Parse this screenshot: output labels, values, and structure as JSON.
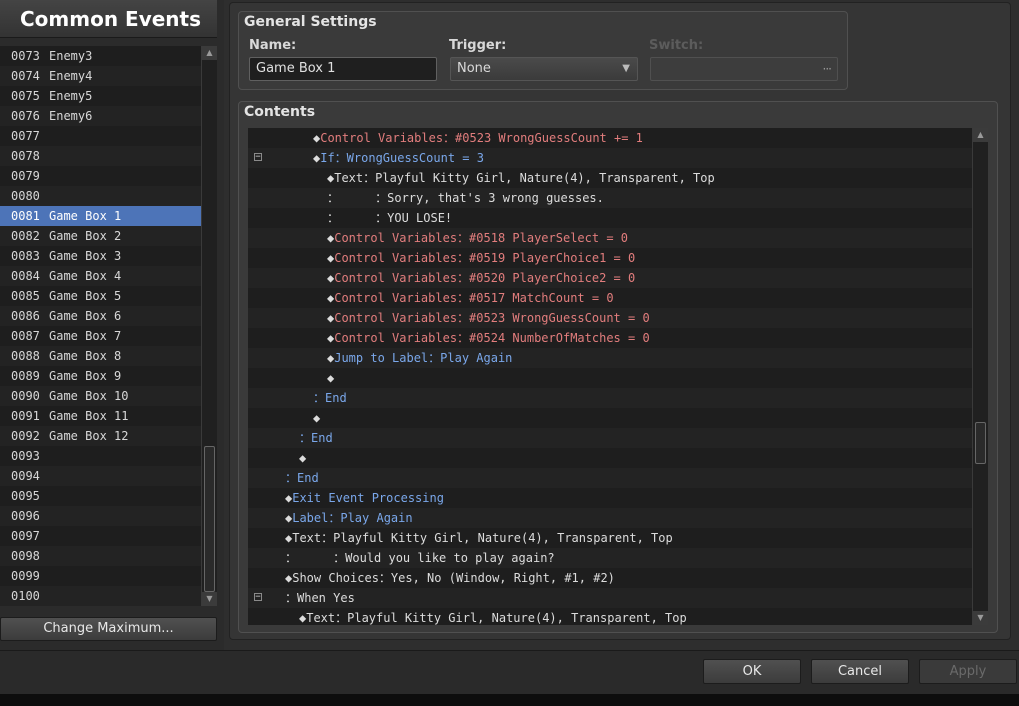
{
  "left_panel": {
    "title": "Common Events",
    "events": [
      {
        "num": "0073",
        "name": "Enemy3"
      },
      {
        "num": "0074",
        "name": "Enemy4"
      },
      {
        "num": "0075",
        "name": "Enemy5"
      },
      {
        "num": "0076",
        "name": "Enemy6"
      },
      {
        "num": "0077",
        "name": ""
      },
      {
        "num": "0078",
        "name": ""
      },
      {
        "num": "0079",
        "name": ""
      },
      {
        "num": "0080",
        "name": ""
      },
      {
        "num": "0081",
        "name": "Game Box 1",
        "selected": true
      },
      {
        "num": "0082",
        "name": "Game Box 2"
      },
      {
        "num": "0083",
        "name": "Game Box 3"
      },
      {
        "num": "0084",
        "name": "Game Box 4"
      },
      {
        "num": "0085",
        "name": "Game Box 5"
      },
      {
        "num": "0086",
        "name": "Game Box 6"
      },
      {
        "num": "0087",
        "name": "Game Box 7"
      },
      {
        "num": "0088",
        "name": "Game Box 8"
      },
      {
        "num": "0089",
        "name": "Game Box 9"
      },
      {
        "num": "0090",
        "name": "Game Box 10"
      },
      {
        "num": "0091",
        "name": "Game Box 11"
      },
      {
        "num": "0092",
        "name": "Game Box 12"
      },
      {
        "num": "0093",
        "name": ""
      },
      {
        "num": "0094",
        "name": ""
      },
      {
        "num": "0095",
        "name": ""
      },
      {
        "num": "0096",
        "name": ""
      },
      {
        "num": "0097",
        "name": ""
      },
      {
        "num": "0098",
        "name": ""
      },
      {
        "num": "0099",
        "name": ""
      },
      {
        "num": "0100",
        "name": ""
      }
    ],
    "change_max_label": "Change Maximum..."
  },
  "general_settings": {
    "title": "General Settings",
    "name_label": "Name:",
    "name_value": "Game Box 1",
    "trigger_label": "Trigger:",
    "trigger_value": "None",
    "switch_label": "Switch:",
    "switch_value": "",
    "switch_button_glyph": "···"
  },
  "contents": {
    "title": "Contents",
    "commands": [
      {
        "indent": 3,
        "segments": [
          [
            "◆",
            "white"
          ],
          [
            "Control Variables：#0523 WrongGuessCount += 1",
            "red"
          ]
        ]
      },
      {
        "indent": 3,
        "collapse": true,
        "segments": [
          [
            "◆",
            "white"
          ],
          [
            "If：WrongGuessCount = 3",
            "blue"
          ]
        ]
      },
      {
        "indent": 4,
        "segments": [
          [
            "◆",
            "white"
          ],
          [
            "Text：Playful Kitty Girl, Nature(4), Transparent, Top",
            "white"
          ]
        ]
      },
      {
        "indent": 4,
        "segments": [
          [
            "：     ：Sorry, that's 3 wrong guesses.",
            "white"
          ]
        ]
      },
      {
        "indent": 4,
        "segments": [
          [
            "：     ：YOU LOSE!",
            "white"
          ]
        ]
      },
      {
        "indent": 4,
        "segments": [
          [
            "◆",
            "white"
          ],
          [
            "Control Variables：#0518 PlayerSelect = 0",
            "red"
          ]
        ]
      },
      {
        "indent": 4,
        "segments": [
          [
            "◆",
            "white"
          ],
          [
            "Control Variables：#0519 PlayerChoice1 = 0",
            "red"
          ]
        ]
      },
      {
        "indent": 4,
        "segments": [
          [
            "◆",
            "white"
          ],
          [
            "Control Variables：#0520 PlayerChoice2 = 0",
            "red"
          ]
        ]
      },
      {
        "indent": 4,
        "segments": [
          [
            "◆",
            "white"
          ],
          [
            "Control Variables：#0517 MatchCount = 0",
            "red"
          ]
        ]
      },
      {
        "indent": 4,
        "segments": [
          [
            "◆",
            "white"
          ],
          [
            "Control Variables：#0523 WrongGuessCount = 0",
            "red"
          ]
        ]
      },
      {
        "indent": 4,
        "segments": [
          [
            "◆",
            "white"
          ],
          [
            "Control Variables：#0524 NumberOfMatches = 0",
            "red"
          ]
        ]
      },
      {
        "indent": 4,
        "segments": [
          [
            "◆",
            "white"
          ],
          [
            "Jump to Label：Play Again",
            "blue"
          ]
        ]
      },
      {
        "indent": 4,
        "segments": [
          [
            "◆",
            "white"
          ]
        ]
      },
      {
        "indent": 3,
        "segments": [
          [
            "：End",
            "blue"
          ]
        ]
      },
      {
        "indent": 3,
        "segments": [
          [
            "◆",
            "white"
          ]
        ]
      },
      {
        "indent": 2,
        "segments": [
          [
            "：End",
            "blue"
          ]
        ]
      },
      {
        "indent": 2,
        "segments": [
          [
            "◆",
            "white"
          ]
        ]
      },
      {
        "indent": 1,
        "segments": [
          [
            "：End",
            "blue"
          ]
        ]
      },
      {
        "indent": 1,
        "segments": [
          [
            "◆",
            "white"
          ],
          [
            "Exit Event Processing",
            "blue"
          ]
        ]
      },
      {
        "indent": 1,
        "segments": [
          [
            "◆",
            "white"
          ],
          [
            "Label：Play Again",
            "blue"
          ]
        ]
      },
      {
        "indent": 1,
        "segments": [
          [
            "◆",
            "white"
          ],
          [
            "Text：Playful Kitty Girl, Nature(4), Transparent, Top",
            "white"
          ]
        ]
      },
      {
        "indent": 1,
        "segments": [
          [
            "：     ：Would you like to play again?",
            "white"
          ]
        ]
      },
      {
        "indent": 1,
        "segments": [
          [
            "◆",
            "white"
          ],
          [
            "Show Choices：Yes, No ",
            "white"
          ],
          [
            "(Window, Right, #1, #2)",
            "white"
          ]
        ]
      },
      {
        "indent": 1,
        "collapse": true,
        "segments": [
          [
            "：When Yes",
            "white"
          ]
        ]
      },
      {
        "indent": 2,
        "segments": [
          [
            "◆",
            "white"
          ],
          [
            "Text：Playful Kitty Girl, Nature(4), Transparent, Top",
            "white"
          ]
        ]
      }
    ]
  },
  "footer": {
    "ok_label": "OK",
    "cancel_label": "Cancel",
    "apply_label": "Apply"
  }
}
